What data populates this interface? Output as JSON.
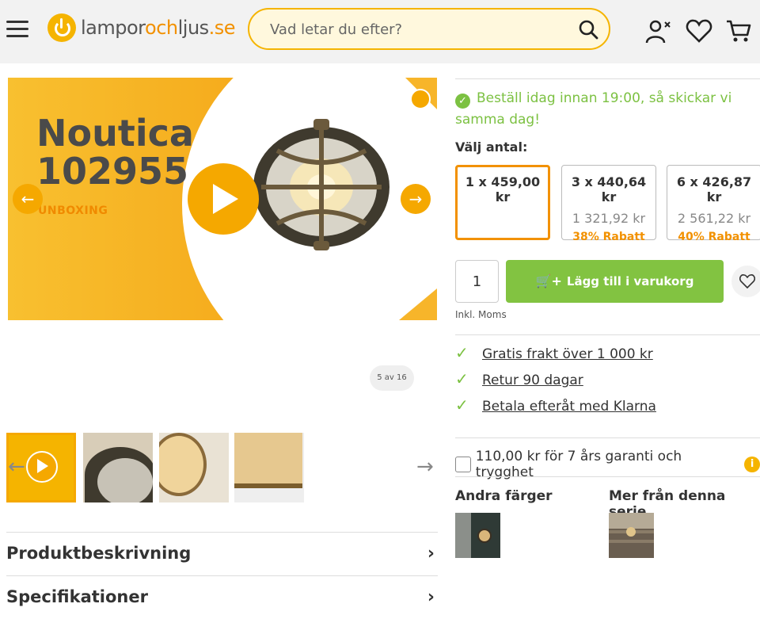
{
  "header": {
    "logo": {
      "part1": "lampor",
      "part2": "och",
      "part3": "ljus",
      "part4": ".se"
    },
    "search": {
      "placeholder": "Vad letar du efter?"
    },
    "icons": [
      "menu-icon",
      "account-icon",
      "heart-icon",
      "cart-icon"
    ]
  },
  "gallery": {
    "title_line1": "Noutica",
    "title_line2": "102955",
    "subtitle": "UNBOXING",
    "counter": "5 av 16",
    "colors": {
      "accent": "#f5a800",
      "dark": "#4a4a4a"
    }
  },
  "accordion": [
    {
      "label": "Produktbeskrivning"
    },
    {
      "label": "Specifikationer"
    }
  ],
  "delivery": {
    "text": "Beställ idag innan 19:00, så skickar vi samma dag!"
  },
  "quantity": {
    "label": "Välj antal:",
    "options": [
      {
        "price": "1 x 459,00 kr",
        "total": "",
        "discount": ""
      },
      {
        "price": "3 x 440,64 kr",
        "total": "1 321,92 kr",
        "discount": "38% Rabatt"
      },
      {
        "price": "6 x 426,87 kr",
        "total": "2 561,22 kr",
        "discount": "40% Rabatt"
      }
    ],
    "input_value": "1"
  },
  "cart": {
    "add_label": "Lägg till i varukorg",
    "tax_note": "Inkl. Moms"
  },
  "usps": [
    {
      "text": "Gratis frakt över 1 000 kr"
    },
    {
      "text": "Retur 90 dagar"
    },
    {
      "text": "Betala efteråt med Klarna"
    }
  ],
  "warranty": {
    "text": "110,00 kr för 7 års garanti och trygghet",
    "info": "i"
  },
  "related": {
    "other_colors": "Andra färger",
    "series": "Mer från denna serie"
  },
  "colors": {
    "brand_orange": "#f29100",
    "green": "#82c341",
    "yellow": "#f5b400"
  }
}
